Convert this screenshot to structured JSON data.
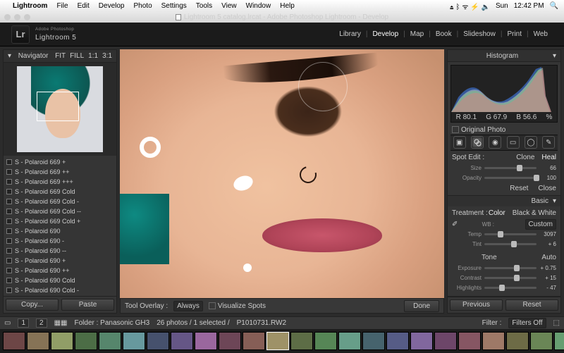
{
  "mac_menu": {
    "app": "Lightroom",
    "items": [
      "File",
      "Edit",
      "Develop",
      "Photo",
      "Settings",
      "Tools",
      "View",
      "Window",
      "Help"
    ],
    "day": "Sun",
    "time": "12:42 PM"
  },
  "window_title": "Lightroom 5 catalog.lrcat - Adobe Photoshop Lightroom - Develop",
  "brand": {
    "eyebrow": "Adobe Photoshop",
    "name": "Lightroom 5",
    "mark": "Lr"
  },
  "modules": [
    "Library",
    "Develop",
    "Map",
    "Book",
    "Slideshow",
    "Print",
    "Web"
  ],
  "active_module": "Develop",
  "left": {
    "navigator": {
      "title": "Navigator",
      "zoom_labels": [
        "FIT",
        "FILL",
        "1:1",
        "3:1"
      ]
    },
    "presets": [
      "S - Polaroid 669 +",
      "S - Polaroid 669 ++",
      "S - Polaroid 669 +++",
      "S - Polaroid 669 Cold",
      "S - Polaroid 669 Cold -",
      "S - Polaroid 669 Cold --",
      "S - Polaroid 669 Cold +",
      "S - Polaroid 690",
      "S - Polaroid 690 -",
      "S - Polaroid 690 --",
      "S - Polaroid 690 +",
      "S - Polaroid 690 ++",
      "S - Polaroid 690 Cold",
      "S - Polaroid 690 Cold -"
    ],
    "copy": "Copy...",
    "paste": "Paste"
  },
  "center": {
    "toolbar": {
      "label": "Tool Overlay :",
      "mode": "Always",
      "vis": "Visualize Spots",
      "done": "Done"
    }
  },
  "right": {
    "histogram": {
      "title": "Histogram",
      "r": "R  80.1",
      "g": "G  67.9",
      "b": "B  56.6",
      "pct": "%",
      "orig": "Original Photo"
    },
    "spot": {
      "title": "Spot Edit :",
      "clone": "Clone",
      "heal": "Heal",
      "size_label": "Size",
      "size_val": "66",
      "opacity_label": "Opacity",
      "opacity_val": "100",
      "reset": "Reset",
      "close": "Close"
    },
    "basic": {
      "title": "Basic",
      "treat": "Treatment :",
      "color": "Color",
      "bw": "Black & White",
      "wb_label": "WB :",
      "wb_val": "Custom",
      "temp_label": "Temp",
      "temp_val": "3097",
      "tint_label": "Tint",
      "tint_val": "+ 6",
      "tone": "Tone",
      "auto": "Auto",
      "exposure_label": "Exposure",
      "exposure_val": "+ 0.75",
      "contrast_label": "Contrast",
      "contrast_val": "+ 15",
      "highlights_label": "Highlights",
      "highlights_val": "- 47"
    },
    "prev": "Previous",
    "reset": "Reset"
  },
  "bottom": {
    "pages": [
      "1",
      "2"
    ],
    "folder": "Folder : Panasonic GH3",
    "count": "26 photos / 1 selected /",
    "file": "P1010731.RW2",
    "filter": "Filter :",
    "filters_off": "Filters Off"
  }
}
